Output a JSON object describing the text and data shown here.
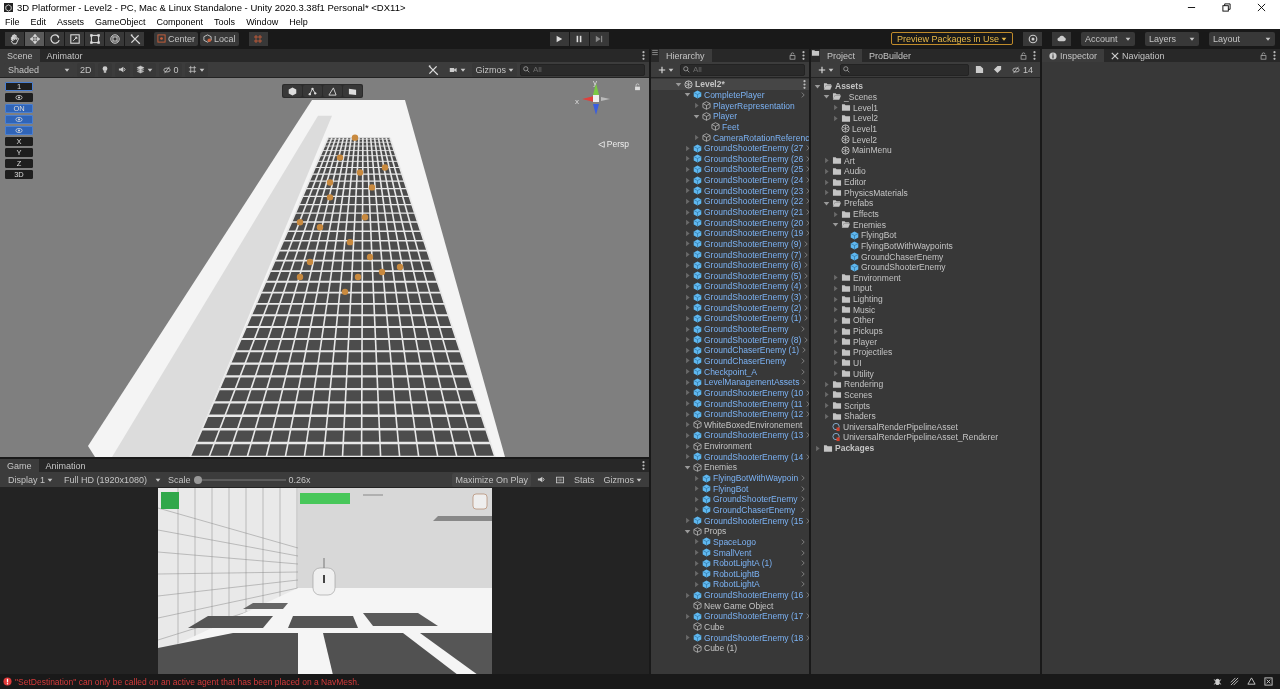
{
  "window": {
    "title": "3D Platformer - Level2 - PC, Mac & Linux Standalone - Unity 2020.3.38f1 Personal* <DX11>"
  },
  "menu": [
    "File",
    "Edit",
    "Assets",
    "GameObject",
    "Component",
    "Tools",
    "Window",
    "Help"
  ],
  "toolbar": {
    "tools": [
      {
        "kind": "hand",
        "selected": false
      },
      {
        "kind": "move",
        "selected": true
      },
      {
        "kind": "rotate",
        "selected": false
      },
      {
        "kind": "scale",
        "selected": false
      },
      {
        "kind": "rect",
        "selected": false
      },
      {
        "kind": "transform",
        "selected": false
      },
      {
        "kind": "custom",
        "selected": false
      }
    ],
    "pivot": "Center",
    "space": "Local",
    "preview_packages": "Preview Packages in Use",
    "account": "Account",
    "layers": "Layers",
    "layout": "Layout"
  },
  "scene_panel": {
    "tabs": [
      {
        "label": "Scene",
        "selected": true
      },
      {
        "label": "Animator",
        "selected": false
      }
    ],
    "shading": "Shaded",
    "mode_2d": "2D",
    "hidden_count": "0",
    "gizmos": "Gizmos",
    "search": {
      "placeholder": "All"
    },
    "overlay": [
      {
        "kind": "text",
        "label": "1",
        "on": false
      },
      {
        "kind": "icon",
        "on": false
      },
      {
        "kind": "text",
        "label": "ON",
        "on": true
      },
      {
        "kind": "icon",
        "on": true
      },
      {
        "kind": "icon",
        "on": true
      },
      {
        "kind": "text",
        "label": "X",
        "on": false
      },
      {
        "kind": "text",
        "label": "Y",
        "on": false
      },
      {
        "kind": "text",
        "label": "Z",
        "on": false
      },
      {
        "kind": "text",
        "label": "3D",
        "on": false
      }
    ],
    "gizmo": {
      "y": "y",
      "x": "x",
      "projection": "Persp"
    }
  },
  "game_panel": {
    "tabs": [
      {
        "label": "Game",
        "selected": true
      },
      {
        "label": "Animation",
        "selected": false
      }
    ],
    "display": "Display 1",
    "resolution": "Full HD (1920x1080)",
    "scale_label": "Scale",
    "scale": {
      "level": 0
    },
    "scale_value": "0.26x",
    "maximize": "Maximize On Play",
    "stats": "Stats",
    "gizmos": "Gizmos"
  },
  "hierarchy": {
    "tabs": [
      {
        "label": "Hierarchy",
        "selected": true
      }
    ],
    "search": {
      "placeholder": "All"
    },
    "items": [
      {
        "name": "Level2*",
        "kind": "scene",
        "expanded": true,
        "children": [
          {
            "name": "CompletePlayer",
            "kind": "prefab",
            "expanded": true,
            "children": [
              {
                "name": "PlayerRepresentation",
                "kind": "prefab-child",
                "expanded": false
              },
              {
                "name": "Player",
                "kind": "prefab-child",
                "expanded": true,
                "children": [
                  {
                    "name": "Feet",
                    "kind": "prefab-child"
                  }
                ]
              },
              {
                "name": "CameraRotationReferenc",
                "kind": "prefab-child",
                "expanded": false
              }
            ]
          },
          {
            "name": "GroundShooterEnemy (27",
            "kind": "prefab",
            "expanded": false
          },
          {
            "name": "GroundShooterEnemy (26",
            "kind": "prefab",
            "expanded": false
          },
          {
            "name": "GroundShooterEnemy (25",
            "kind": "prefab",
            "expanded": false
          },
          {
            "name": "GroundShooterEnemy (24",
            "kind": "prefab",
            "expanded": false
          },
          {
            "name": "GroundShooterEnemy (23",
            "kind": "prefab",
            "expanded": false
          },
          {
            "name": "GroundShooterEnemy (22",
            "kind": "prefab",
            "expanded": false
          },
          {
            "name": "GroundShooterEnemy (21",
            "kind": "prefab",
            "expanded": false
          },
          {
            "name": "GroundShooterEnemy (20",
            "kind": "prefab",
            "expanded": false
          },
          {
            "name": "GroundShooterEnemy (19",
            "kind": "prefab",
            "expanded": false
          },
          {
            "name": "GroundShooterEnemy (9)",
            "kind": "prefab",
            "expanded": false
          },
          {
            "name": "GroundShooterEnemy (7)",
            "kind": "prefab",
            "expanded": false
          },
          {
            "name": "GroundShooterEnemy (6)",
            "kind": "prefab",
            "expanded": false
          },
          {
            "name": "GroundShooterEnemy (5)",
            "kind": "prefab",
            "expanded": false
          },
          {
            "name": "GroundShooterEnemy (4)",
            "kind": "prefab",
            "expanded": false
          },
          {
            "name": "GroundShooterEnemy (3)",
            "kind": "prefab",
            "expanded": false
          },
          {
            "name": "GroundShooterEnemy (2)",
            "kind": "prefab",
            "expanded": false
          },
          {
            "name": "GroundShooterEnemy (1)",
            "kind": "prefab",
            "expanded": false
          },
          {
            "name": "GroundShooterEnemy",
            "kind": "prefab",
            "expanded": false
          },
          {
            "name": "GroundShooterEnemy (8)",
            "kind": "prefab",
            "expanded": false
          },
          {
            "name": "GroundChaserEnemy (1)",
            "kind": "prefab",
            "expanded": false
          },
          {
            "name": "GroundChaserEnemy",
            "kind": "prefab",
            "expanded": false
          },
          {
            "name": "Checkpoint_A",
            "kind": "prefab",
            "expanded": false
          },
          {
            "name": "LevelManagementAssets",
            "kind": "prefab",
            "expanded": false
          },
          {
            "name": "GroundShooterEnemy (10",
            "kind": "prefab",
            "expanded": false
          },
          {
            "name": "GroundShooterEnemy (11",
            "kind": "prefab",
            "expanded": false
          },
          {
            "name": "GroundShooterEnemy (12",
            "kind": "prefab",
            "expanded": false
          },
          {
            "name": "WhiteBoxedEnvironement",
            "kind": "object",
            "expanded": false
          },
          {
            "name": "GroundShooterEnemy (13",
            "kind": "prefab",
            "expanded": false
          },
          {
            "name": "Environment",
            "kind": "object",
            "expanded": false
          },
          {
            "name": "GroundShooterEnemy (14",
            "kind": "prefab",
            "expanded": false
          },
          {
            "name": "Enemies",
            "kind": "object",
            "expanded": true,
            "children": [
              {
                "name": "FlyingBotWithWaypoin",
                "kind": "prefab",
                "expanded": false
              },
              {
                "name": "FlyingBot",
                "kind": "prefab",
                "expanded": false
              },
              {
                "name": "GroundShooterEnemy",
                "kind": "prefab",
                "expanded": false
              },
              {
                "name": "GroundChaserEnemy",
                "kind": "prefab",
                "expanded": false
              }
            ]
          },
          {
            "name": "GroundShooterEnemy (15",
            "kind": "prefab",
            "expanded": false
          },
          {
            "name": "Props",
            "kind": "object",
            "expanded": true,
            "children": [
              {
                "name": "SpaceLogo",
                "kind": "prefab",
                "expanded": false
              },
              {
                "name": "SmallVent",
                "kind": "prefab",
                "expanded": false
              },
              {
                "name": "RobotLightA (1)",
                "kind": "prefab",
                "expanded": false
              },
              {
                "name": "RobotLightB",
                "kind": "prefab",
                "expanded": false
              },
              {
                "name": "RobotLightA",
                "kind": "prefab",
                "expanded": false
              }
            ]
          },
          {
            "name": "GroundShooterEnemy (16",
            "kind": "prefab",
            "expanded": false
          },
          {
            "name": "New Game Object",
            "kind": "object"
          },
          {
            "name": "GroundShooterEnemy (17",
            "kind": "prefab",
            "expanded": false
          },
          {
            "name": "Cube",
            "kind": "object"
          },
          {
            "name": "GroundShooterEnemy (18",
            "kind": "prefab",
            "expanded": false
          },
          {
            "name": "Cube (1)",
            "kind": "object"
          }
        ]
      }
    ]
  },
  "project": {
    "tabs": [
      {
        "label": "Project",
        "selected": true
      },
      {
        "label": "ProBuilder",
        "selected": false
      }
    ],
    "hidden_count": "14",
    "items": [
      {
        "name": "Assets",
        "kind": "root",
        "expanded": true,
        "children": [
          {
            "name": "_Scenes",
            "kind": "folder",
            "expanded": true,
            "children": [
              {
                "name": "Level1",
                "kind": "folder",
                "expanded": false
              },
              {
                "name": "Level2",
                "kind": "folder",
                "expanded": false
              },
              {
                "name": "Level1",
                "kind": "scene"
              },
              {
                "name": "Level2",
                "kind": "scene"
              },
              {
                "name": "MainMenu",
                "kind": "scene"
              }
            ]
          },
          {
            "name": "Art",
            "kind": "folder",
            "expanded": false
          },
          {
            "name": "Audio",
            "kind": "folder",
            "expanded": false
          },
          {
            "name": "Editor",
            "kind": "folder",
            "expanded": false
          },
          {
            "name": "PhysicsMaterials",
            "kind": "folder",
            "expanded": false
          },
          {
            "name": "Prefabs",
            "kind": "folder",
            "expanded": true,
            "children": [
              {
                "name": "Effects",
                "kind": "folder",
                "expanded": false
              },
              {
                "name": "Enemies",
                "kind": "folder",
                "expanded": true,
                "children": [
                  {
                    "name": "FlyingBot",
                    "kind": "prefab"
                  },
                  {
                    "name": "FlyingBotWithWaypoints",
                    "kind": "prefab"
                  },
                  {
                    "name": "GroundChaserEnemy",
                    "kind": "prefab"
                  },
                  {
                    "name": "GroundShooterEnemy",
                    "kind": "prefab"
                  }
                ]
              },
              {
                "name": "Environment",
                "kind": "folder",
                "expanded": false
              },
              {
                "name": "Input",
                "kind": "folder",
                "expanded": false
              },
              {
                "name": "Lighting",
                "kind": "folder",
                "expanded": false
              },
              {
                "name": "Music",
                "kind": "folder",
                "expanded": false
              },
              {
                "name": "Other",
                "kind": "folder",
                "expanded": false
              },
              {
                "name": "Pickups",
                "kind": "folder",
                "expanded": false
              },
              {
                "name": "Player",
                "kind": "folder",
                "expanded": false
              },
              {
                "name": "Projectiles",
                "kind": "folder",
                "expanded": false
              },
              {
                "name": "UI",
                "kind": "folder",
                "expanded": false
              },
              {
                "name": "Utility",
                "kind": "folder",
                "expanded": false
              }
            ]
          },
          {
            "name": "Rendering",
            "kind": "folder",
            "expanded": false
          },
          {
            "name": "Scenes",
            "kind": "folder",
            "expanded": false
          },
          {
            "name": "Scripts",
            "kind": "folder",
            "expanded": false
          },
          {
            "name": "Shaders",
            "kind": "folder",
            "expanded": false
          },
          {
            "name": "UniversalRenderPipelineAsset",
            "kind": "asset"
          },
          {
            "name": "UniversalRenderPipelineAsset_Renderer",
            "kind": "asset"
          }
        ]
      },
      {
        "name": "Packages",
        "kind": "root",
        "expanded": false
      }
    ]
  },
  "inspector": {
    "tabs": [
      {
        "label": "Inspector",
        "selected": true
      },
      {
        "label": "Navigation",
        "selected": false
      }
    ]
  },
  "status_bar": {
    "message": "\"SetDestination\" can only be called on an active agent that has been placed on a NavMesh."
  }
}
